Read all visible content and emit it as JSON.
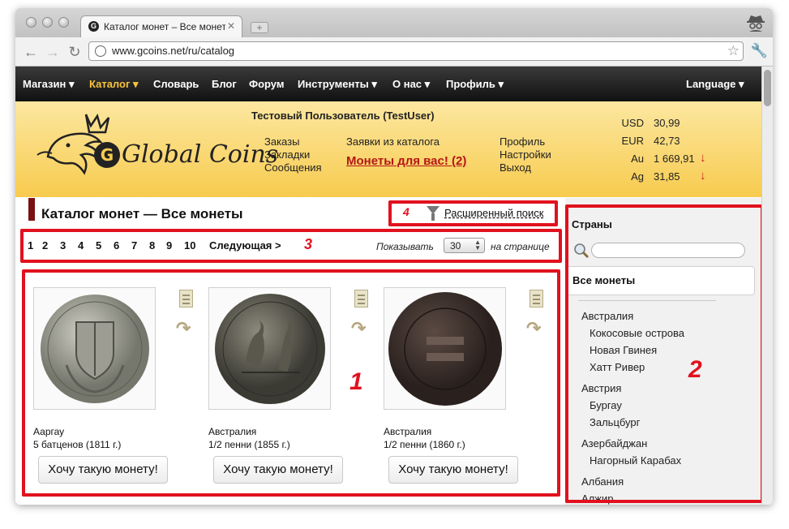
{
  "browser": {
    "tab_title": "Каталог монет – Все монеты",
    "tab_favicon": "G",
    "tab_close": "✕",
    "new_tab": "+",
    "url": "www.gcoins.net/ru/catalog"
  },
  "menu": {
    "items": [
      "Магазин ▾",
      "Каталог ▾",
      "Словарь",
      "Блог",
      "Форум",
      "Инструменты ▾",
      "О нас ▾",
      "Профиль ▾"
    ],
    "language": "Language ▾"
  },
  "header": {
    "logo": "Global Coins",
    "user": "Тестовый Пользователь (TestUser)",
    "links_col1": [
      "Заказы",
      "Закладки",
      "Сообщения"
    ],
    "links_col2": [
      "Заявки из каталога"
    ],
    "promo": "Монеты для вас! (2)",
    "links_col3": [
      "Профиль",
      "Настройки",
      "Выход"
    ],
    "rates": [
      {
        "name": "USD",
        "value": "30,99",
        "trend": ""
      },
      {
        "name": "EUR",
        "value": "42,73",
        "trend": ""
      },
      {
        "name": "Au",
        "value": "1 669,91",
        "trend": "↓"
      },
      {
        "name": "Ag",
        "value": "31,85",
        "trend": "↓"
      }
    ]
  },
  "catalog": {
    "title": "Каталог монет — Все монеты",
    "advanced_search": "Расширенный поиск",
    "pages": [
      "1",
      "2",
      "3",
      "4",
      "5",
      "6",
      "7",
      "8",
      "9",
      "10"
    ],
    "next": "Следующая >",
    "show_label": "Показывать",
    "per_page": "30",
    "per_page_suffix": "на странице",
    "coins": [
      {
        "country": "Ааргау",
        "name": "5 батценов (1811 г.)",
        "button": "Хочу такую монету!"
      },
      {
        "country": "Австралия",
        "name": "1/2 пенни (1855 г.)",
        "button": "Хочу такую монету!"
      },
      {
        "country": "Австралия",
        "name": "1/2 пенни (1860 г.)",
        "button": "Хочу такую монету!"
      }
    ]
  },
  "sidebar": {
    "title": "Страны",
    "all": "Все монеты",
    "countries": [
      {
        "name": "Австралия",
        "level": 0
      },
      {
        "name": "Кокосовые острова",
        "level": 1
      },
      {
        "name": "Новая Гвинея",
        "level": 1
      },
      {
        "name": "Хатт Ривер",
        "level": 1
      },
      {
        "name": "Австрия",
        "level": 0
      },
      {
        "name": "Бургау",
        "level": 1
      },
      {
        "name": "Зальцбург",
        "level": 1
      },
      {
        "name": "Азербайджан",
        "level": 0
      },
      {
        "name": "Нагорный Карабах",
        "level": 1
      },
      {
        "name": "Албания",
        "level": 0
      },
      {
        "name": "Алжир",
        "level": 0
      }
    ]
  },
  "annotations": [
    "1",
    "2",
    "3",
    "4"
  ],
  "colors": {
    "annotation_red": "#e1111e",
    "menu_active": "#f7c33c",
    "promo": "#b41616"
  }
}
